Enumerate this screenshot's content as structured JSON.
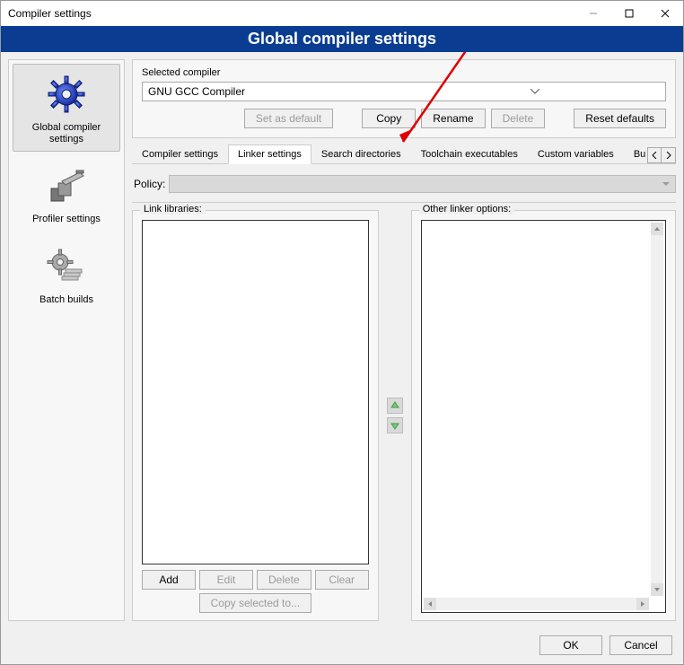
{
  "window": {
    "title": "Compiler settings"
  },
  "banner": "Global compiler settings",
  "sidebar": {
    "items": [
      {
        "label": "Global compiler settings"
      },
      {
        "label": "Profiler settings"
      },
      {
        "label": "Batch builds"
      }
    ]
  },
  "selected_compiler": {
    "label": "Selected compiler",
    "value": "GNU GCC Compiler",
    "buttons": {
      "set_default": "Set as default",
      "copy": "Copy",
      "rename": "Rename",
      "delete": "Delete",
      "reset": "Reset defaults"
    }
  },
  "tabs": {
    "items": [
      "Compiler settings",
      "Linker settings",
      "Search directories",
      "Toolchain executables",
      "Custom variables",
      "Build"
    ],
    "active_index": 1
  },
  "policy": {
    "label": "Policy:"
  },
  "link_libs": {
    "legend": "Link libraries:",
    "buttons": {
      "add": "Add",
      "edit": "Edit",
      "delete": "Delete",
      "clear": "Clear",
      "copy": "Copy selected to..."
    }
  },
  "other_linker": {
    "legend": "Other linker options:"
  },
  "footer": {
    "ok": "OK",
    "cancel": "Cancel"
  }
}
